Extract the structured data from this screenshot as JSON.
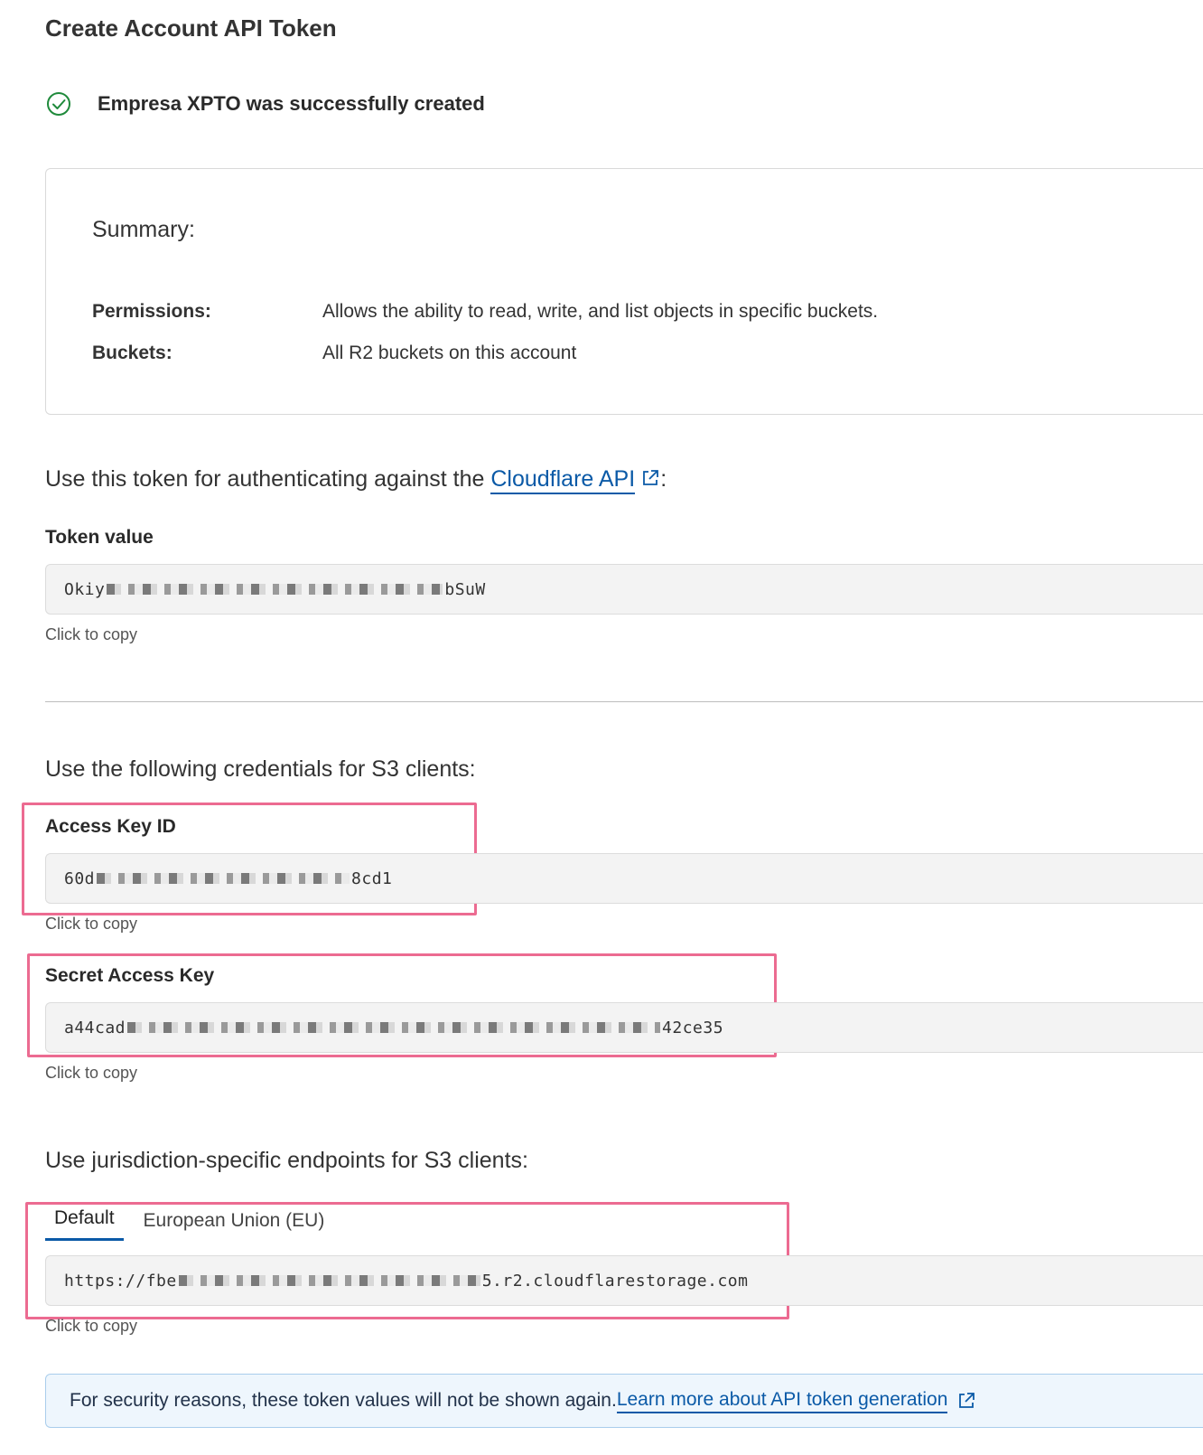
{
  "page": {
    "title": "Create Account API Token"
  },
  "success": {
    "message": "Empresa XPTO was successfully created"
  },
  "summary": {
    "heading": "Summary:",
    "rows": [
      {
        "label": "Permissions:",
        "value": "Allows the ability to read, write, and list objects in specific buckets."
      },
      {
        "label": "Buckets:",
        "value": "All R2 buckets on this account"
      }
    ]
  },
  "api_section": {
    "lead_text": "Use this token for authenticating against the ",
    "link_text": "Cloudflare API",
    "trailing": ":",
    "token_label": "Token value",
    "token_prefix": "Okiy",
    "token_suffix": "bSuW",
    "copy_hint": "Click to copy"
  },
  "s3_section": {
    "lead_text": "Use the following credentials for S3 clients:",
    "access_key_label": "Access Key ID",
    "access_key_prefix": "60d",
    "access_key_suffix": "8cd1",
    "secret_key_label": "Secret Access Key",
    "secret_key_prefix": "a44cad",
    "secret_key_suffix": "42ce35",
    "copy_hint": "Click to copy"
  },
  "endpoints_section": {
    "lead_text": "Use jurisdiction-specific endpoints for S3 clients:",
    "tabs": [
      {
        "label": "Default",
        "active": true
      },
      {
        "label": "European Union (EU)",
        "active": false
      }
    ],
    "endpoint_prefix": "https://fbe",
    "endpoint_suffix": "5.r2.cloudflarestorage.com",
    "copy_hint": "Click to copy"
  },
  "notice": {
    "text": "For security reasons, these token values will not be shown again. ",
    "link_text": "Learn more about API token generation"
  },
  "colors": {
    "accent_link": "#0b5aa7",
    "highlight_border": "#ec6b91",
    "success_green": "#1f8a3b",
    "notice_bg": "#eef6fd"
  },
  "icons": {
    "success": "check-circle-icon",
    "external_link": "external-link-icon"
  }
}
